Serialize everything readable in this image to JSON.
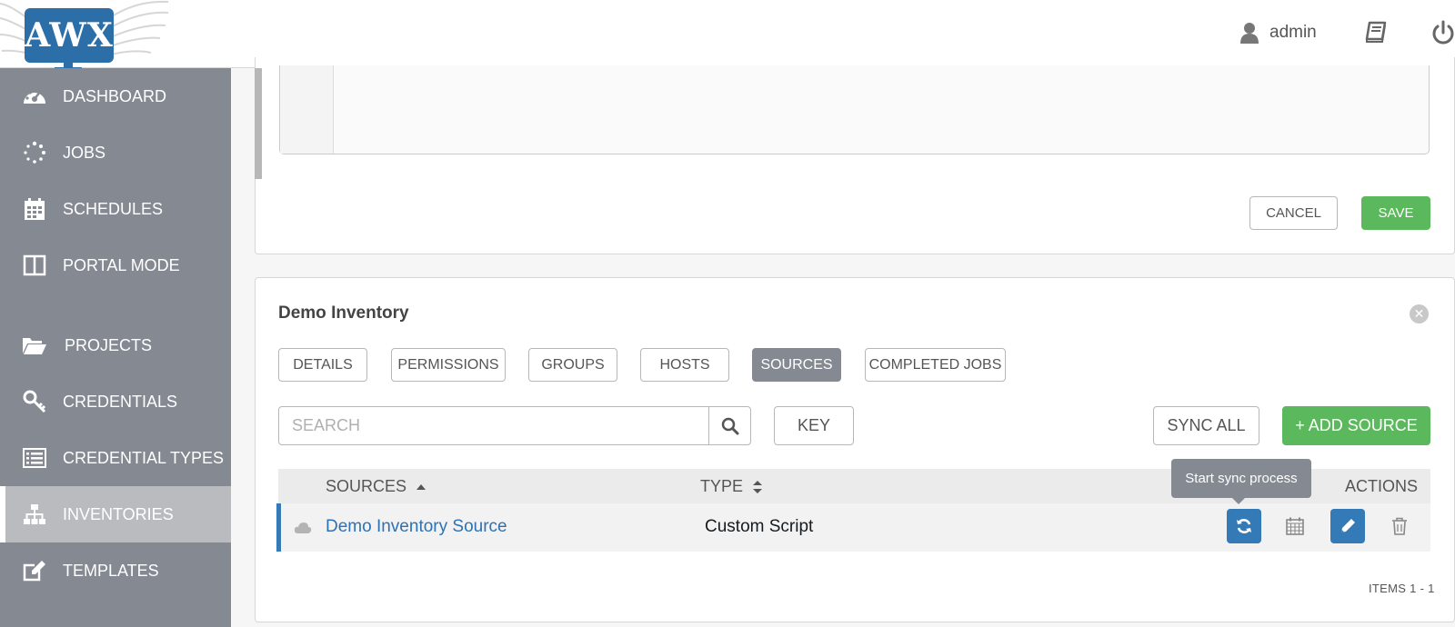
{
  "header": {
    "logo_text": "AWX",
    "username": "admin",
    "icons": [
      "user-icon",
      "docs-book-icon",
      "power-icon"
    ]
  },
  "sidebar": {
    "items": [
      {
        "label": "DASHBOARD",
        "icon": "dashboard-gauge-icon"
      },
      {
        "label": "JOBS",
        "icon": "jobs-spinner-icon"
      },
      {
        "label": "SCHEDULES",
        "icon": "calendar-icon"
      },
      {
        "label": "PORTAL MODE",
        "icon": "portal-columns-icon"
      },
      {
        "label": "PROJECTS",
        "icon": "folder-open-icon"
      },
      {
        "label": "CREDENTIALS",
        "icon": "key-icon"
      },
      {
        "label": "CREDENTIAL TYPES",
        "icon": "list-card-icon"
      },
      {
        "label": "INVENTORIES",
        "icon": "sitemap-icon",
        "active": true
      },
      {
        "label": "TEMPLATES",
        "icon": "edit-square-icon"
      }
    ]
  },
  "form": {
    "cancel_label": "CANCEL",
    "save_label": "SAVE"
  },
  "inventory": {
    "title": "Demo Inventory",
    "tabs": [
      {
        "label": "DETAILS"
      },
      {
        "label": "PERMISSIONS"
      },
      {
        "label": "GROUPS"
      },
      {
        "label": "HOSTS"
      },
      {
        "label": "SOURCES",
        "active": true
      },
      {
        "label": "COMPLETED JOBS"
      }
    ],
    "search": {
      "placeholder": "SEARCH"
    },
    "key_label": "KEY",
    "sync_all_label": "SYNC ALL",
    "add_source_label": "+ ADD SOURCE",
    "table": {
      "columns": {
        "sources": "SOURCES",
        "type": "TYPE",
        "actions": "ACTIONS"
      },
      "rows": [
        {
          "name": "Demo Inventory Source",
          "type": "Custom Script",
          "status_icon": "cloud-icon"
        }
      ]
    },
    "tooltip": "Start sync process",
    "items_count": "ITEMS  1 - 1"
  },
  "colors": {
    "sidebar_bg": "#848992",
    "primary_blue": "#337ab7",
    "success_green": "#5cb85c",
    "link_blue": "#2c72b4"
  }
}
